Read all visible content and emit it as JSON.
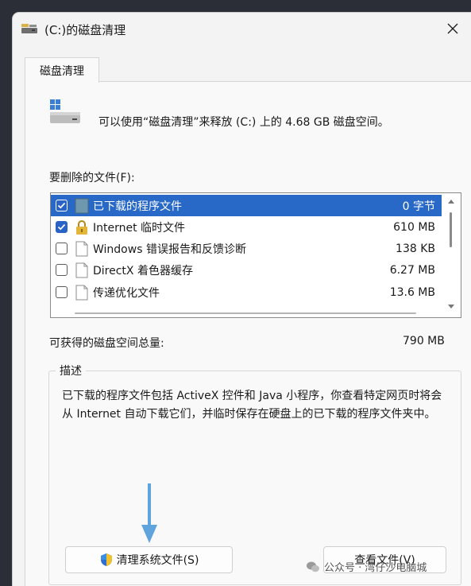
{
  "window": {
    "title": "(C:)的磁盘清理",
    "close_icon": "close-icon"
  },
  "tab": {
    "label": "磁盘清理"
  },
  "intro": {
    "text": "可以使用“磁盘清理”来释放  (C:) 上的 4.68 GB 磁盘空间。"
  },
  "list": {
    "label": "要删除的文件(F):",
    "items": [
      {
        "name": "已下载的程序文件",
        "size": "0 字节",
        "checked": true,
        "selected": true,
        "icon": "folder-icon"
      },
      {
        "name": "Internet 临时文件",
        "size": "610 MB",
        "checked": true,
        "selected": false,
        "icon": "lock-icon"
      },
      {
        "name": "Windows 错误报告和反馈诊断",
        "size": "138 KB",
        "checked": false,
        "selected": false,
        "icon": "file-icon"
      },
      {
        "name": "DirectX 着色器缓存",
        "size": "6.27 MB",
        "checked": false,
        "selected": false,
        "icon": "file-icon"
      },
      {
        "name": "传递优化文件",
        "size": "13.6 MB",
        "checked": false,
        "selected": false,
        "icon": "file-icon"
      }
    ]
  },
  "total": {
    "label": "可获得的磁盘空间总量:",
    "value": "790 MB"
  },
  "description": {
    "legend": "描述",
    "text": "已下载的程序文件包括 ActiveX 控件和 Java 小程序，你查看特定网页时将会从 Internet 自动下载它们，并临时保存在硬盘上的已下载的程序文件夹中。"
  },
  "buttons": {
    "cleanup_system": "清理系统文件(S)",
    "view_files": "查看文件(V)"
  },
  "watermark": {
    "text": "公众号 · 湾仔沙电脑城"
  },
  "colors": {
    "selection": "#2869c7",
    "checkbox": "#2a63c6",
    "arrow": "#5fa4dc"
  }
}
